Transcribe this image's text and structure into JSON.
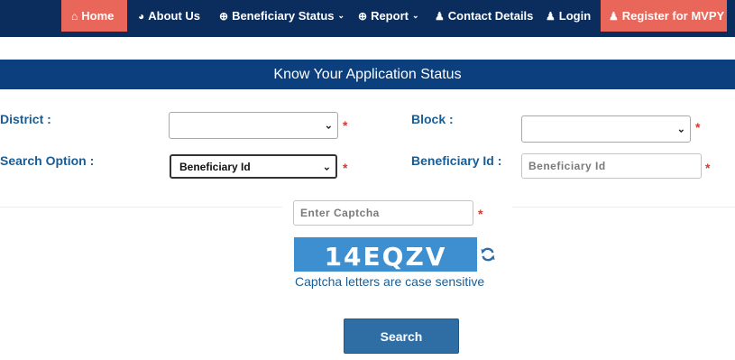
{
  "nav": {
    "items": [
      {
        "label": "Home",
        "icon": "home-icon"
      },
      {
        "label": "About Us",
        "icon": "dashboard-icon"
      },
      {
        "label": "Beneficiary Status",
        "icon": "circle-plus-icon",
        "dropdown": true
      },
      {
        "label": "Report",
        "icon": "circle-plus-icon",
        "dropdown": true
      },
      {
        "label": "Contact Details",
        "icon": "user-icon"
      },
      {
        "label": "Login",
        "icon": "user-icon"
      },
      {
        "label": "Register for MVPY",
        "icon": "user-icon"
      }
    ]
  },
  "header": {
    "title": "Know Your Application Status"
  },
  "form": {
    "district": {
      "label": "District   :",
      "value": ""
    },
    "block": {
      "label": "Block  :",
      "value": ""
    },
    "search_option": {
      "label": "Search Option  :",
      "value": "Beneficiary Id"
    },
    "beneficiary_id": {
      "label": "Beneficiary Id :",
      "placeholder": "Beneficiary Id"
    },
    "required_mark": "*"
  },
  "captcha": {
    "placeholder": "Enter Captcha",
    "code": "14EQZV",
    "note": "Captcha letters are case sensitive",
    "refresh_icon": "refresh-icon"
  },
  "search_button": {
    "label": "Search"
  },
  "colors": {
    "nav_bg": "#0b2d5e",
    "nav_active": "#e8675a",
    "header_bg": "#0b3f7e",
    "label": "#1a5d94",
    "required": "#d43a2f",
    "captcha_bg": "#3d8fcf",
    "button_bg": "#2f6da5"
  }
}
